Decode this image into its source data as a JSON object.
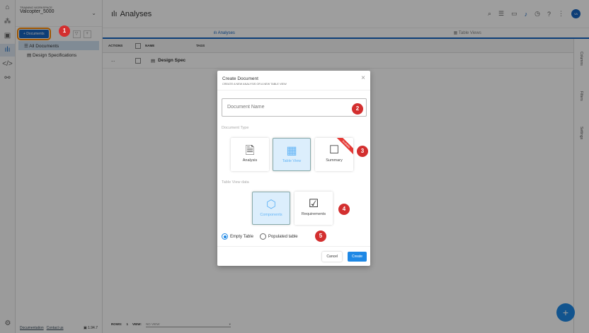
{
  "workspace": {
    "label": "TRAINING WORKSPACE",
    "name": "Valcopter_5000"
  },
  "sidebar": {
    "new_button": "+ Documents",
    "items": [
      {
        "label": "All Documents"
      },
      {
        "label": "Design Specifications"
      }
    ],
    "footer": {
      "docs": "Documentation",
      "contact": "Contact us",
      "version": "1.94.7"
    }
  },
  "header": {
    "title": "Analyses",
    "avatar": "VA"
  },
  "tabs": [
    {
      "label": "Analyses"
    },
    {
      "label": "Table Views"
    }
  ],
  "table": {
    "columns": [
      "ACTIONS",
      "NAME",
      "TAGS"
    ],
    "rows": [
      {
        "actions": "...",
        "name": "Design Spec"
      }
    ]
  },
  "right_panel": [
    "Columns",
    "Filters",
    "Settings"
  ],
  "footer": {
    "rows_label": "ROWS:",
    "rows": "1",
    "view_label": "VIEW:",
    "view": "NO VIEW"
  },
  "modal": {
    "title": "Create Document",
    "subtitle": "CREATE A NEW ANALYSIS OR A NEW TABLE VIEW",
    "name_placeholder": "Document Name",
    "type_label": "Document Type",
    "types": [
      {
        "label": "Analysis"
      },
      {
        "label": "Table View"
      },
      {
        "label": "Summary",
        "ribbon": "Available"
      }
    ],
    "data_label": "Table View data",
    "data_options": [
      {
        "label": "Components"
      },
      {
        "label": "Requirements"
      }
    ],
    "radios": [
      {
        "label": "Empty Table",
        "checked": true
      },
      {
        "label": "Populated table",
        "checked": false
      }
    ],
    "cancel": "Cancel",
    "create": "Create"
  },
  "badges": [
    "1",
    "2",
    "3",
    "4",
    "5"
  ],
  "colors": {
    "primary": "#1565c0",
    "badge": "#d32f2f",
    "highlight": "#ff8a00"
  }
}
